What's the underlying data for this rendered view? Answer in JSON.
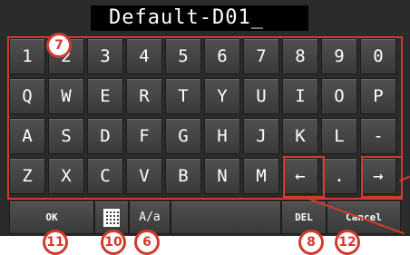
{
  "input": {
    "value": "Default-D01_"
  },
  "keys": [
    "1",
    "2",
    "3",
    "4",
    "5",
    "6",
    "7",
    "8",
    "9",
    "0",
    "Q",
    "W",
    "E",
    "R",
    "T",
    "Y",
    "U",
    "I",
    "O",
    "P",
    "A",
    "S",
    "D",
    "F",
    "G",
    "H",
    "J",
    "K",
    "L",
    "-",
    "Z",
    "X",
    "C",
    "V",
    "B",
    "N",
    "M",
    "←",
    ".",
    "→"
  ],
  "bottom": {
    "ok_label": "OK",
    "keyboard_icon": "keyboard-grid-icon",
    "case_label": "A/a",
    "del_label": "DEL",
    "cancel_label": "Cancel"
  },
  "markers": {
    "keys": "7",
    "ok": "11",
    "grid": "10",
    "case": "6",
    "del": "8",
    "cancel": "12"
  },
  "colors": {
    "accent": "#d23a2e",
    "key": "#444444",
    "text": "#ffffff"
  }
}
